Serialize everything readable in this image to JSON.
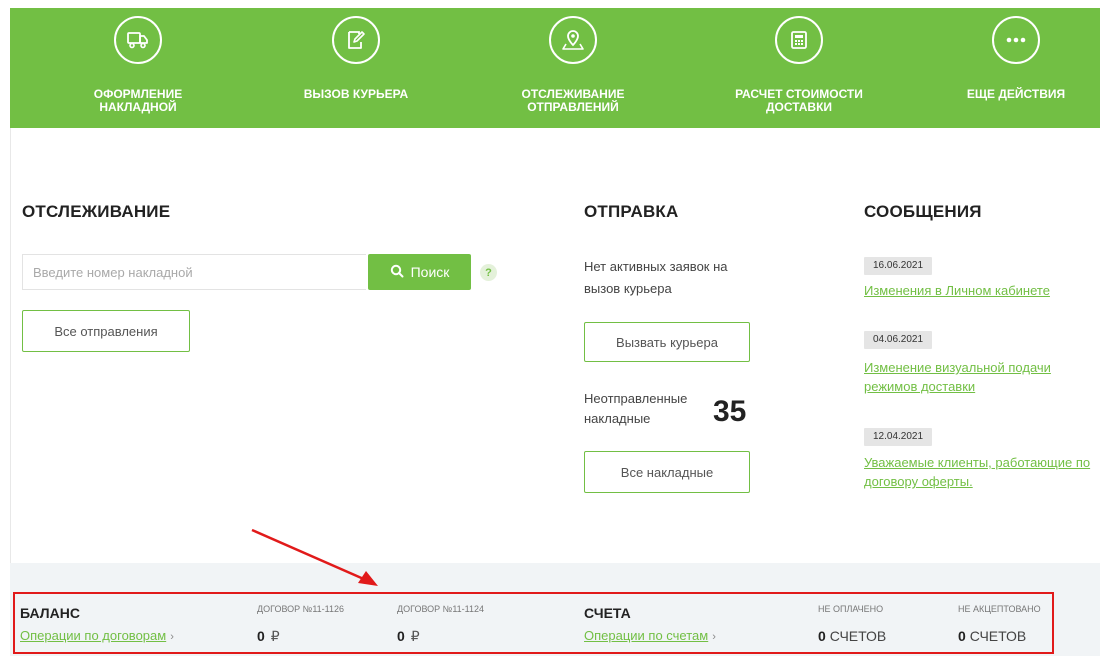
{
  "top_nav": {
    "items": [
      {
        "label": "ОФОРМЛЕНИЕ\nНАКЛАДНОЙ",
        "icon": "truck-icon"
      },
      {
        "label": "ВЫЗОВ КУРЬЕРА",
        "icon": "edit-document-icon"
      },
      {
        "label": "ОТСЛЕЖИВАНИЕ\nОТПРАВЛЕНИЙ",
        "icon": "map-pin-icon"
      },
      {
        "label": "РАСЧЕТ СТОИМОСТИ\nДОСТАВКИ",
        "icon": "calculator-icon"
      },
      {
        "label": "ЕЩЕ ДЕЙСТВИЯ",
        "icon": "more-dots-icon"
      }
    ],
    "background_color": "#72bf44"
  },
  "tracking": {
    "title": "ОТСЛЕЖИВАНИЕ",
    "search_placeholder": "Введите номер накладной",
    "search_value": "",
    "search_button_label": "Поиск",
    "help_label": "?",
    "all_shipments_label": "Все отправления"
  },
  "sending": {
    "title": "ОТПРАВКА",
    "no_requests_text": "Нет активных заявок на\nвызов курьера",
    "call_courier_label": "Вызвать курьера",
    "unsent_label": "Неотправленные\nнакладные",
    "unsent_count": "35",
    "all_waybills_label": "Все накладные"
  },
  "messages": {
    "title": "СООБЩЕНИЯ",
    "items": [
      {
        "date": "16.06.2021",
        "text": "Изменения в Личном кабинете"
      },
      {
        "date": "04.06.2021",
        "text": "Изменение визуальной подачи\nрежимов доставки"
      },
      {
        "date": "12.04.2021",
        "text": "Уважаемые клиенты, работающие по\nдоговору оферты."
      }
    ]
  },
  "balance": {
    "title": "БАЛАНС",
    "operations_link": "Операции по договорам",
    "chevron": "›",
    "contracts": [
      {
        "label": "ДОГОВОР №11-1126",
        "value": "0",
        "currency": "₽"
      },
      {
        "label": "ДОГОВОР №11-1124",
        "value": "0",
        "currency": "₽"
      }
    ]
  },
  "invoices": {
    "title": "СЧЕТА",
    "operations_link": "Операции по счетам",
    "chevron": "›",
    "unpaid_label": "НЕ ОПЛАЧЕНО",
    "unpaid_value": "0",
    "unpaid_unit": "СЧЕТОВ",
    "unaccepted_label": "НЕ АКЦЕПТОВАНО",
    "unaccepted_value": "0",
    "unaccepted_unit": "СЧЕТОВ"
  },
  "colors": {
    "accent": "#72bf44",
    "annotation": "#e11a1a",
    "panel_bg": "#f1f4f6"
  }
}
